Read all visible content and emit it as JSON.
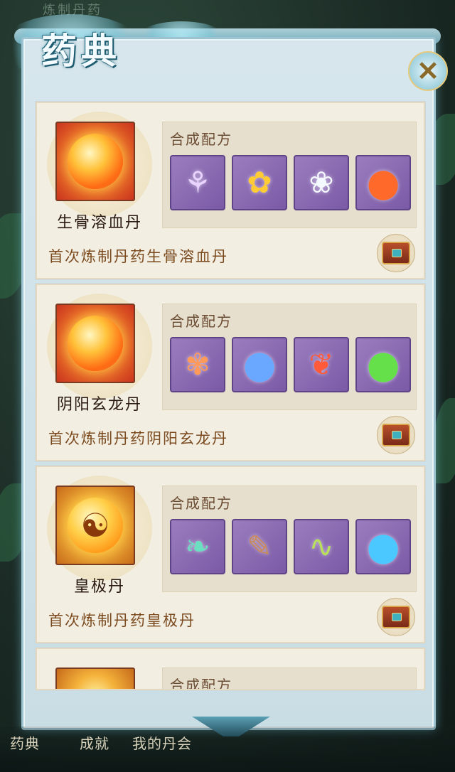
{
  "background": {
    "screen_title": "炼制丹药"
  },
  "header": {
    "title": "药典",
    "close_icon": "close-x-icon"
  },
  "recipe_label": "合成配方",
  "pills": [
    {
      "name": "生骨溶血丹",
      "quest": "首次炼制丹药生骨溶血丹",
      "frame": "red",
      "ingredients": [
        {
          "icon": "purple-lily-flower-icon",
          "glyph": "⚘"
        },
        {
          "icon": "golden-flower-icon",
          "glyph": "✿"
        },
        {
          "icon": "white-lotus-icon",
          "glyph": "❀"
        },
        {
          "icon": "fire-orb-icon",
          "glyph": "●"
        }
      ],
      "reward_icon": "treasure-chest-icon"
    },
    {
      "name": "阴阳玄龙丹",
      "quest": "首次炼制丹药阴阳玄龙丹",
      "frame": "red",
      "ingredients": [
        {
          "icon": "fire-lotus-icon",
          "glyph": "✾"
        },
        {
          "icon": "blue-crystal-orb-icon",
          "glyph": "●"
        },
        {
          "icon": "flame-feather-icon",
          "glyph": "❦"
        },
        {
          "icon": "green-energy-orb-icon",
          "glyph": "●"
        }
      ],
      "reward_icon": "open-treasure-chest-icon"
    },
    {
      "name": "皇极丹",
      "quest": "首次炼制丹药皇极丹",
      "frame": "amber",
      "ingredients": [
        {
          "icon": "jade-herb-branch-icon",
          "glyph": "❧"
        },
        {
          "icon": "wooden-root-icon",
          "glyph": "✎"
        },
        {
          "icon": "green-vine-icon",
          "glyph": "∿"
        },
        {
          "icon": "blue-water-orb-icon",
          "glyph": "●"
        }
      ],
      "reward_icon": "treasure-chest-icon"
    }
  ],
  "partial_card": {
    "recipe_label": "合成配方"
  },
  "bottom_menu": {
    "items": [
      "药典",
      "成就",
      "我的丹会"
    ]
  },
  "colors": {
    "panel": "#d6e6ec",
    "card": "#f3eee2",
    "ingredient_bg": "#8a6bb4",
    "quest_text": "#7a4a1e"
  }
}
